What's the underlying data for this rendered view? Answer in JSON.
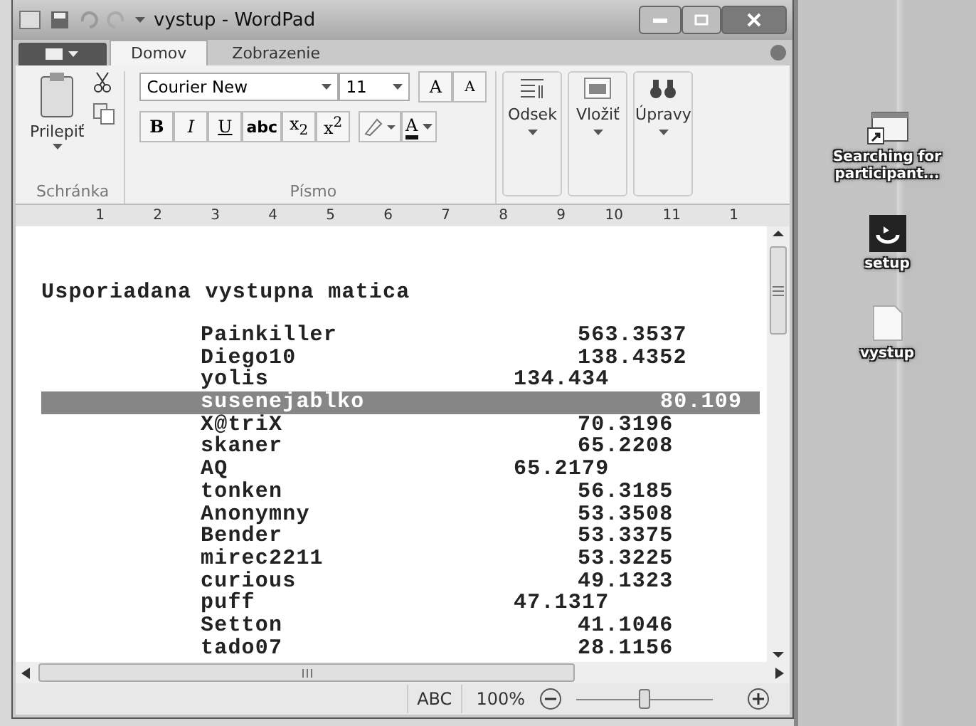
{
  "window": {
    "title": "vystup - WordPad"
  },
  "tabs": [
    {
      "label": "Domov",
      "selected": true
    },
    {
      "label": "Zobrazenie",
      "selected": false
    }
  ],
  "ribbon": {
    "paste": "Prilepiť",
    "clipboard_group": "Schránka",
    "font_name": "Courier New",
    "font_size": "11",
    "grow_font": "A",
    "shrink_font": "A",
    "format_buttons": [
      {
        "label": "B",
        "kind": "bold"
      },
      {
        "label": "I",
        "kind": "italic"
      },
      {
        "label": "U",
        "kind": "underline"
      },
      {
        "label": "abc",
        "kind": "strike"
      },
      {
        "label": "x$_{2}$",
        "kind": "plain"
      },
      {
        "label": "x$^{2}$",
        "kind": "plain"
      }
    ],
    "font_color": "A",
    "font_group": "Písmo",
    "big_buttons": [
      "Odsek",
      "Vložiť",
      "Úpravy"
    ]
  },
  "ruler": [
    "1",
    "2",
    "3",
    "4",
    "5",
    "6",
    "7",
    "8",
    "9",
    "10",
    "11",
    "1"
  ],
  "document": {
    "heading": "Usporiadana vystupna matica",
    "rows": [
      {
        "name": "Painkiller",
        "value": "563.3537",
        "kind": "far",
        "selected": false
      },
      {
        "name": "Diego10",
        "value": "138.4352",
        "kind": "far",
        "selected": false
      },
      {
        "name": "yolis",
        "value": "134.434",
        "kind": "near",
        "selected": false
      },
      {
        "name": "susenejablko",
        "value": "80.109",
        "kind": "edge",
        "selected": true
      },
      {
        "name": "X@triX",
        "value": "70.3196",
        "kind": "far",
        "selected": false
      },
      {
        "name": "skaner",
        "value": "65.2208",
        "kind": "far",
        "selected": false
      },
      {
        "name": "AQ",
        "value": "65.2179",
        "kind": "near",
        "selected": false
      },
      {
        "name": "tonken",
        "value": "56.3185",
        "kind": "far",
        "selected": false
      },
      {
        "name": "Anonymny",
        "value": "53.3508",
        "kind": "far",
        "selected": false
      },
      {
        "name": "Bender",
        "value": "53.3375",
        "kind": "far",
        "selected": false
      },
      {
        "name": "mirec2211",
        "value": "53.3225",
        "kind": "far",
        "selected": false
      },
      {
        "name": "curious",
        "value": "49.1323",
        "kind": "far",
        "selected": false
      },
      {
        "name": "puff",
        "value": "47.1317",
        "kind": "near",
        "selected": false
      },
      {
        "name": "Setton",
        "value": "41.1046",
        "kind": "far",
        "selected": false
      },
      {
        "name": "tado07",
        "value": "28.1156",
        "kind": "far",
        "selected": false
      }
    ]
  },
  "status_bar": {
    "language": "ABC",
    "zoom": "100%",
    "zoom_slider": {
      "level": 0.5
    }
  },
  "desktop_icons": [
    {
      "label": "Searching for participant...",
      "kind": "shortcut"
    },
    {
      "label": "setup",
      "kind": "setup"
    },
    {
      "label": "vystup",
      "kind": "file"
    }
  ]
}
